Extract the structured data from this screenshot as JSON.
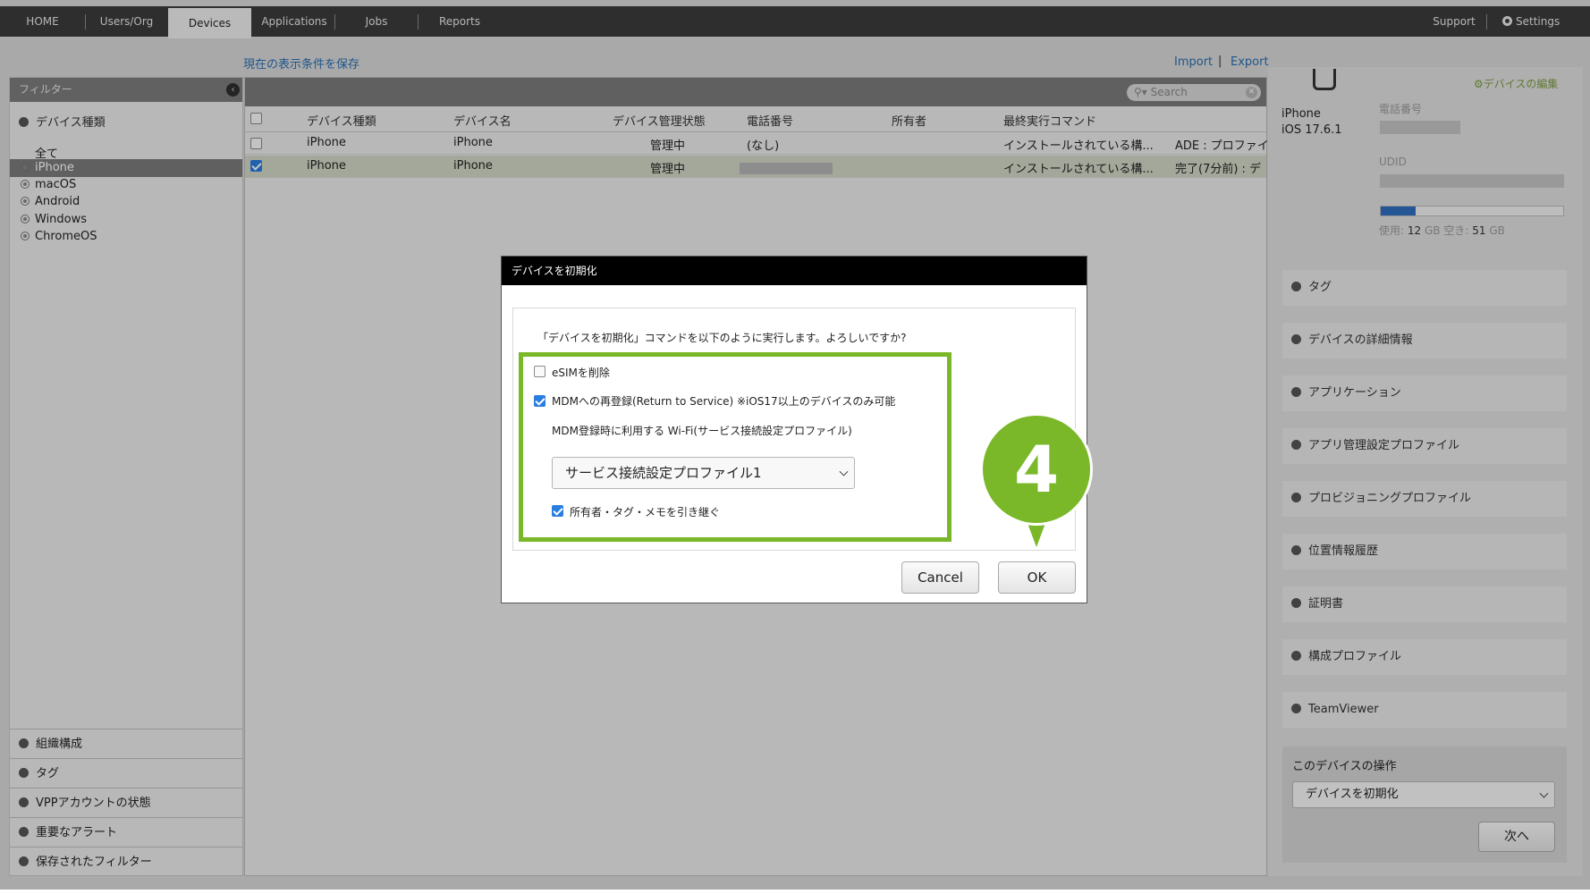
{
  "topnav": {
    "tabs": [
      "HOME",
      "Users/Org",
      "Devices",
      "Applications",
      "Jobs",
      "Reports"
    ],
    "active_tab": "Devices",
    "support": "Support",
    "settings": "Settings"
  },
  "toolbar": {
    "save_conditions": "現在の表示条件を保存",
    "import": "Import",
    "separator": "|",
    "export": "Export"
  },
  "filter": {
    "title": "フィルター",
    "device_type_title": "デバイス種類",
    "types": [
      "全て",
      "iPhone",
      "macOS",
      "Android",
      "Windows",
      "ChromeOS"
    ],
    "selected_type": "iPhone",
    "bottom_sections": [
      "組織構成",
      "タグ",
      "VPPアカウントの状態",
      "重要なアラート",
      "保存されたフィルター"
    ]
  },
  "table": {
    "search_placeholder": "Search",
    "columns": [
      "デバイス種類",
      "デバイス名",
      "デバイス管理状態",
      "電話番号",
      "所有者",
      "最終実行コマンド"
    ],
    "rows": [
      {
        "type": "iPhone",
        "name": "iPhone",
        "status": "管理中",
        "phone": "(なし)",
        "owner": "",
        "last_command": "インストールされている構...",
        "extra": "ADE : プロファイ",
        "selected": false
      },
      {
        "type": "iPhone",
        "name": "iPhone",
        "status": "管理中",
        "phone": "",
        "owner": "",
        "last_command": "インストールされている構...",
        "extra": "完了(7分前) : デ",
        "selected": true
      }
    ]
  },
  "detail": {
    "edit_link": "デバイスの編集",
    "device_model": "iPhone",
    "os_version": "iOS 17.6.1",
    "phone_label": "電話番号",
    "udid_label": "UDID",
    "storage": {
      "used_label": "使用:",
      "used_value": "12",
      "free_label": "空き:",
      "free_value": "51",
      "unit": "GB",
      "used_fraction": 0.19
    },
    "sections": [
      "タグ",
      "デバイスの詳細情報",
      "アプリケーション",
      "アプリ管理設定プロファイル",
      "プロビジョニングプロファイル",
      "位置情報履歴",
      "証明書",
      "構成プロファイル",
      "TeamViewer"
    ],
    "operation_title": "このデバイスの操作",
    "operation_value": "デバイスを初期化",
    "next_button": "次へ"
  },
  "modal": {
    "title": "デバイスを初期化",
    "question": "「デバイスを初期化」コマンドを以下のように実行します。よろしいですか?",
    "esim_label": "eSIMを削除",
    "esim_checked": false,
    "rts_label": "MDMへの再登録(Return to Service) ※iOS17以上のデバイスのみ可能",
    "rts_checked": true,
    "wifi_label": "MDM登録時に利用する Wi-Fi(サービス接続設定プロファイル)",
    "wifi_profile_value": "サービス接続設定プロファイル1",
    "inherit_label": "所有者・タグ・メモを引き継ぐ",
    "inherit_checked": true,
    "cancel_button": "Cancel",
    "ok_button": "OK"
  },
  "callout": {
    "number": "4"
  },
  "colors": {
    "accent_green": "#7ab829",
    "link_blue": "#2a6fb3",
    "checkbox_blue": "#2a7de1"
  }
}
